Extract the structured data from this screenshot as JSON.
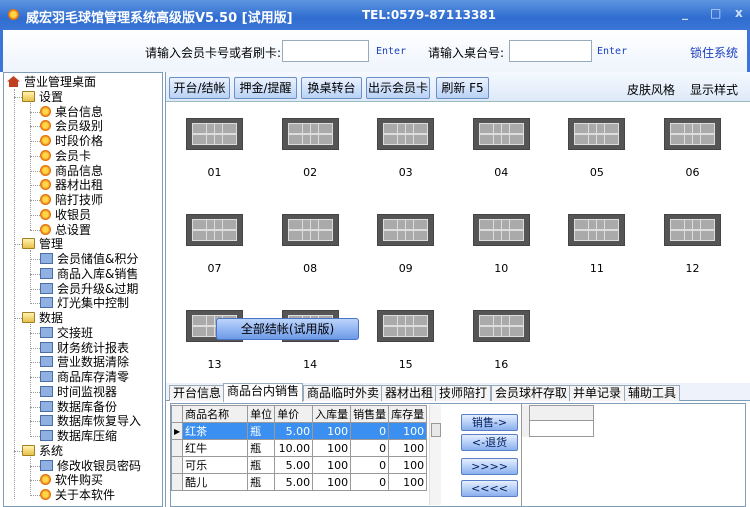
{
  "titlebar": {
    "title": "威宏羽毛球馆管理系统高级版V5.50 [试用版]",
    "tel": "TEL:0579-87113381",
    "min": "_",
    "max": "□",
    "close": "x"
  },
  "topbar": {
    "card_label": "请输入会员卡号或者刷卡:",
    "card_value": "",
    "enter1": "Enter",
    "table_label": "请输入桌台号:",
    "table_value": "",
    "enter2": "Enter",
    "lock": "锁住系统"
  },
  "tree": {
    "root": "营业管理桌面",
    "groups": [
      {
        "label": "设置",
        "items": [
          "桌台信息",
          "会员级别",
          "时段价格",
          "会员卡",
          "商品信息",
          "器材出租",
          "陪打技师",
          "收银员",
          "总设置"
        ]
      },
      {
        "label": "管理",
        "items": [
          "会员储值&积分",
          "商品入库&销售",
          "会员升级&过期",
          "灯光集中控制"
        ]
      },
      {
        "label": "数据",
        "items": [
          "交接班",
          "财务统计报表",
          "营业数据清除",
          "商品库存清零",
          "时间监视器",
          "数据库备份",
          "数据库恢复导入",
          "数据库压缩"
        ]
      },
      {
        "label": "系统",
        "items": [
          "修改收银员密码",
          "软件购买",
          "关于本软件"
        ]
      }
    ]
  },
  "toolbar": {
    "buttons": [
      "开台/结帐",
      "押金/提醒",
      "换桌转台",
      "出示会员卡",
      "刷新 F5"
    ],
    "skin": "皮肤风格",
    "display": "显示样式"
  },
  "courts": [
    "01",
    "02",
    "03",
    "04",
    "05",
    "06",
    "07",
    "08",
    "09",
    "10",
    "11",
    "12",
    "13",
    "14",
    "15",
    "16"
  ],
  "popup": "全部结帐(试用版)",
  "tabs": [
    "开台信息",
    "商品台内销售",
    "商品临时外卖",
    "器材出租",
    "技师陪打",
    "会员球杆存取",
    "并单记录",
    "辅助工具"
  ],
  "active_tab": 1,
  "goods": {
    "headers": [
      "商品名称",
      "单位",
      "单价",
      "入库量",
      "销售量",
      "库存量"
    ],
    "rows": [
      [
        "红茶",
        "瓶",
        "5.00",
        "100",
        "0",
        "100"
      ],
      [
        "红牛",
        "瓶",
        "10.00",
        "100",
        "0",
        "100"
      ],
      [
        "可乐",
        "瓶",
        "5.00",
        "100",
        "0",
        "100"
      ],
      [
        "酷儿",
        "瓶",
        "5.00",
        "100",
        "0",
        "100"
      ]
    ]
  },
  "actions": [
    "销售->",
    "<-退货",
    ">>>>",
    "<<<<"
  ],
  "colors": {
    "title": "#2f6dd0",
    "selection": "#3a8ff0"
  }
}
